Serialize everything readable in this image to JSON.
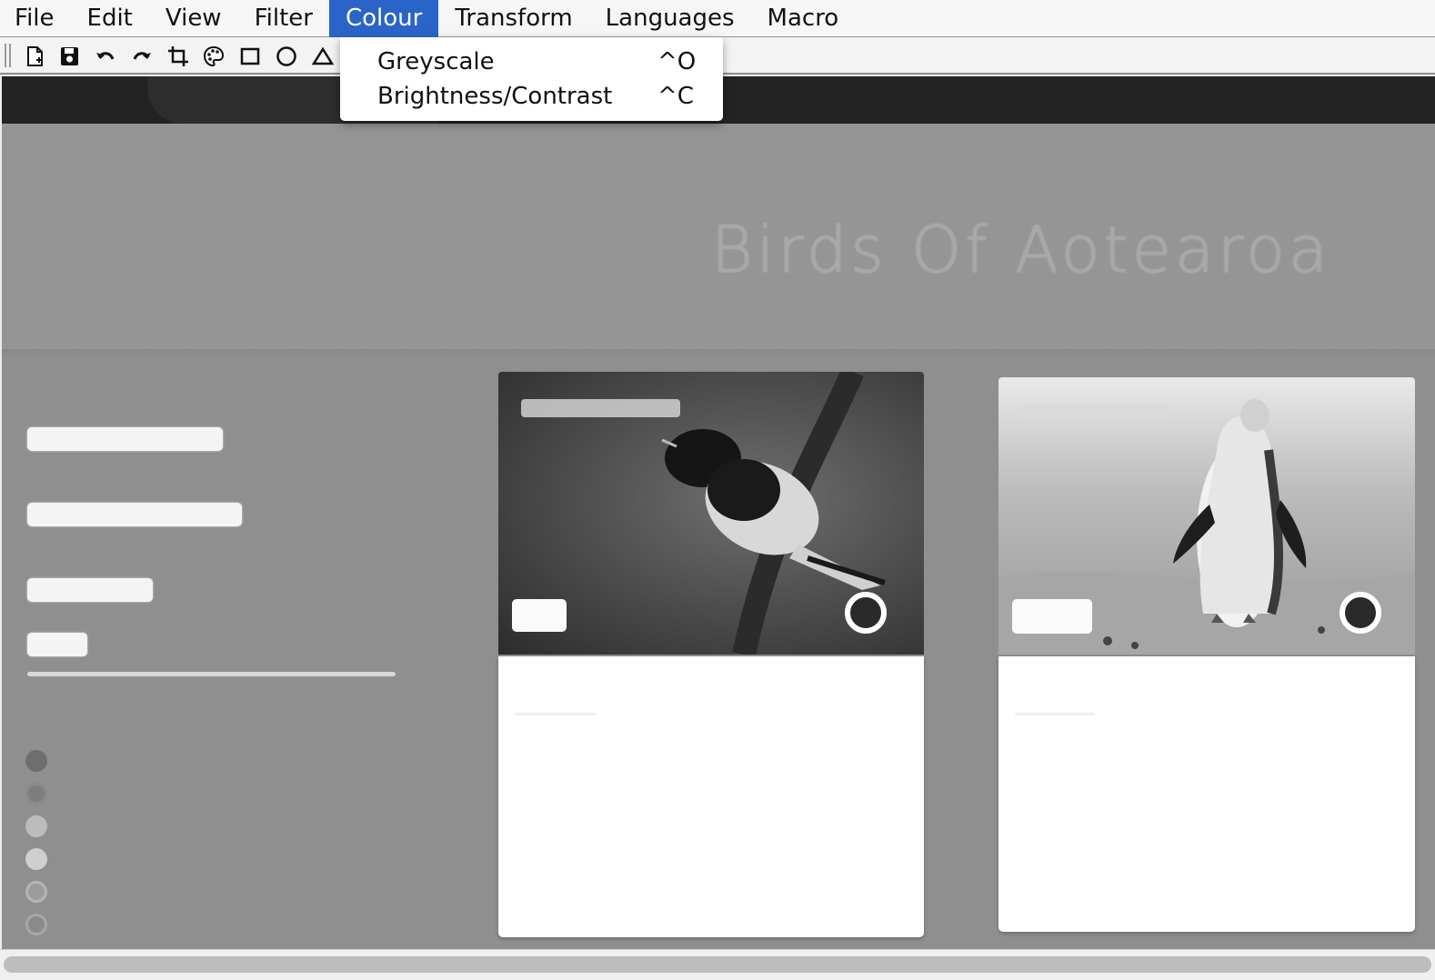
{
  "menubar": {
    "items": [
      "File",
      "Edit",
      "View",
      "Filter",
      "Colour",
      "Transform",
      "Languages",
      "Macro"
    ],
    "active": "Colour"
  },
  "toolbar": {
    "tools": [
      "new-file-icon",
      "save-icon",
      "undo-icon",
      "redo-icon",
      "crop-icon",
      "palette-icon",
      "rectangle-icon",
      "circle-icon",
      "triangle-icon"
    ]
  },
  "colour_menu": {
    "items": [
      {
        "label": "Greyscale",
        "shortcut": "^O"
      },
      {
        "label": "Brightness/Contrast",
        "shortcut": "^C"
      }
    ]
  },
  "canvas": {
    "hero_title": "Birds Of Aotearoa",
    "cards": [
      {
        "subject": "bird on branch"
      },
      {
        "subject": "penguin on beach"
      }
    ]
  },
  "colors": {
    "menu_active": "#2a64c8",
    "canvas_bg": "#8f8f8f",
    "header_dark": "#232323"
  }
}
